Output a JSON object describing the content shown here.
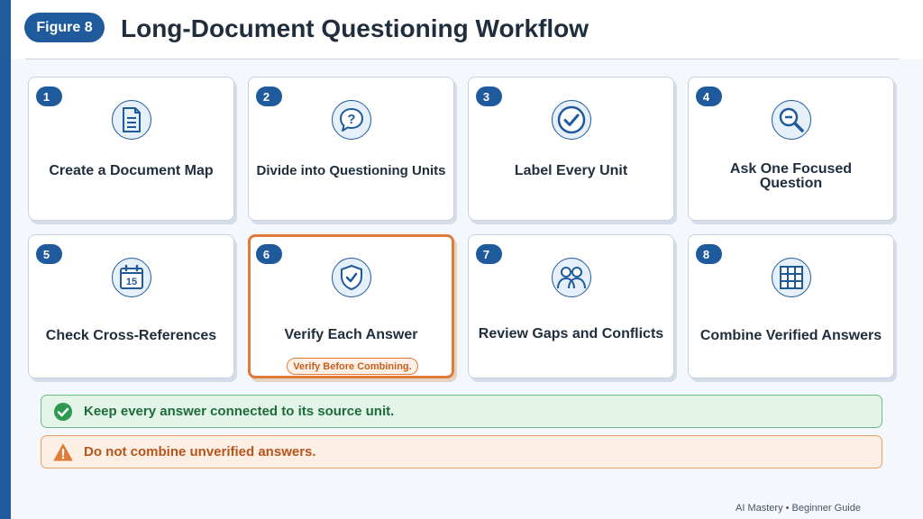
{
  "header": {
    "figure_label": "Figure 8",
    "title": "Long-Document Questioning Workflow"
  },
  "steps": [
    {
      "number": "1",
      "label": "Create a Document Map",
      "icon": "document-icon"
    },
    {
      "number": "2",
      "label": "Divide into Questioning Units",
      "icon": "question-bubble-icon"
    },
    {
      "number": "3",
      "label": "Label Every Unit",
      "icon": "checkmark-icon"
    },
    {
      "number": "4",
      "label": "Ask One Focused Question",
      "icon": "magnifier-icon"
    },
    {
      "number": "5",
      "label": "Check Cross-References",
      "icon": "calendar-icon",
      "icon_text": "15"
    },
    {
      "number": "6",
      "label": "Verify Each Answer",
      "icon": "shield-check-icon",
      "tag": "Verify Before Combining.",
      "highlighted": true
    },
    {
      "number": "7",
      "label": "Review Gaps and Conflicts",
      "icon": "people-icon"
    },
    {
      "number": "8",
      "label": "Combine Verified Answers",
      "icon": "grid-icon"
    }
  ],
  "banners": {
    "keep": "Keep every answer connected to its source unit.",
    "avoid": "Do not combine unverified answers."
  },
  "footer": "AI Mastery • Beginner Guide",
  "colors": {
    "primary": "#1e5a9c",
    "highlight": "#e07b39",
    "success": "#2e9a4f",
    "warning": "#e07b39"
  }
}
